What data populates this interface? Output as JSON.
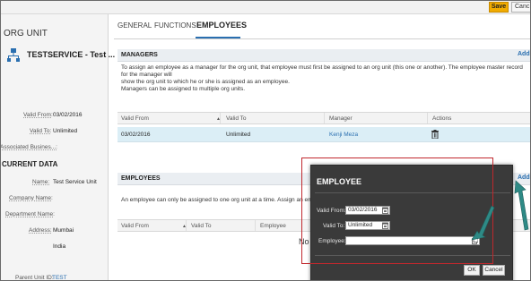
{
  "topbar": {
    "save_label": "Save",
    "cancel_label": "Canc"
  },
  "left": {
    "header": "ORG UNIT",
    "title": "TESTSERVICE - Test ...",
    "valid_from_label": "Valid From:",
    "valid_from_value": "03/02/2016",
    "valid_to_label": "Valid To:",
    "valid_to_value": "Unlimited",
    "assoc_label": "Associated Busines...:",
    "current_data": "CURRENT DATA",
    "name_label": "Name:",
    "name_value": "Test Service Unit",
    "company_label": "Company Name:",
    "department_label": "Department Name:",
    "address_label": "Address:",
    "address_line1": "Mumbai",
    "address_line2": "India",
    "parent_label": "Parent Unit ID:",
    "parent_value": "TEST"
  },
  "tabs": [
    {
      "label": "GENERAL"
    },
    {
      "label": "FUNCTIONS"
    },
    {
      "label": "EMPLOYEES"
    }
  ],
  "managers": {
    "title": "MANAGERS",
    "add_label": "Add",
    "desc_line1": "To assign an employee as a manager for the org unit, that employee must first be assigned to an org unit (this one or another). The employee master record for the manager will",
    "desc_line2": "show the org unit to which he or she is assigned as an employee.",
    "desc_line3": "Managers can be assigned to multiple org units.",
    "columns": [
      "Valid From",
      "Valid To",
      "Manager",
      "Actions"
    ],
    "rows": [
      {
        "valid_from": "03/02/2016",
        "valid_to": "Unlimited",
        "manager": "Kenji Meza"
      }
    ]
  },
  "employees": {
    "title": "EMPLOYEES",
    "add_label": "Add",
    "desc": "An employee can only be assigned to one org unit at a time.  Assign an employe",
    "columns": [
      "Valid From",
      "Valid To",
      "Employee"
    ],
    "no_data": "No"
  },
  "popup": {
    "title": "EMPLOYEE",
    "valid_from_label": "Valid From:",
    "valid_from_value": "03/02/2016",
    "valid_to_label": "Valid To:",
    "valid_to_value": "Unlimited",
    "employee_label": "Employee:",
    "employee_value": "",
    "ok_label": "OK",
    "cancel_label": "Cancel"
  },
  "colors": {
    "accent": "#2a6fb0",
    "save": "#f0ab00",
    "row_selected": "#dbeef6",
    "popup_bg": "#3a3a3a",
    "highlight": "#c0282d",
    "arrow": "#2e8a86"
  }
}
